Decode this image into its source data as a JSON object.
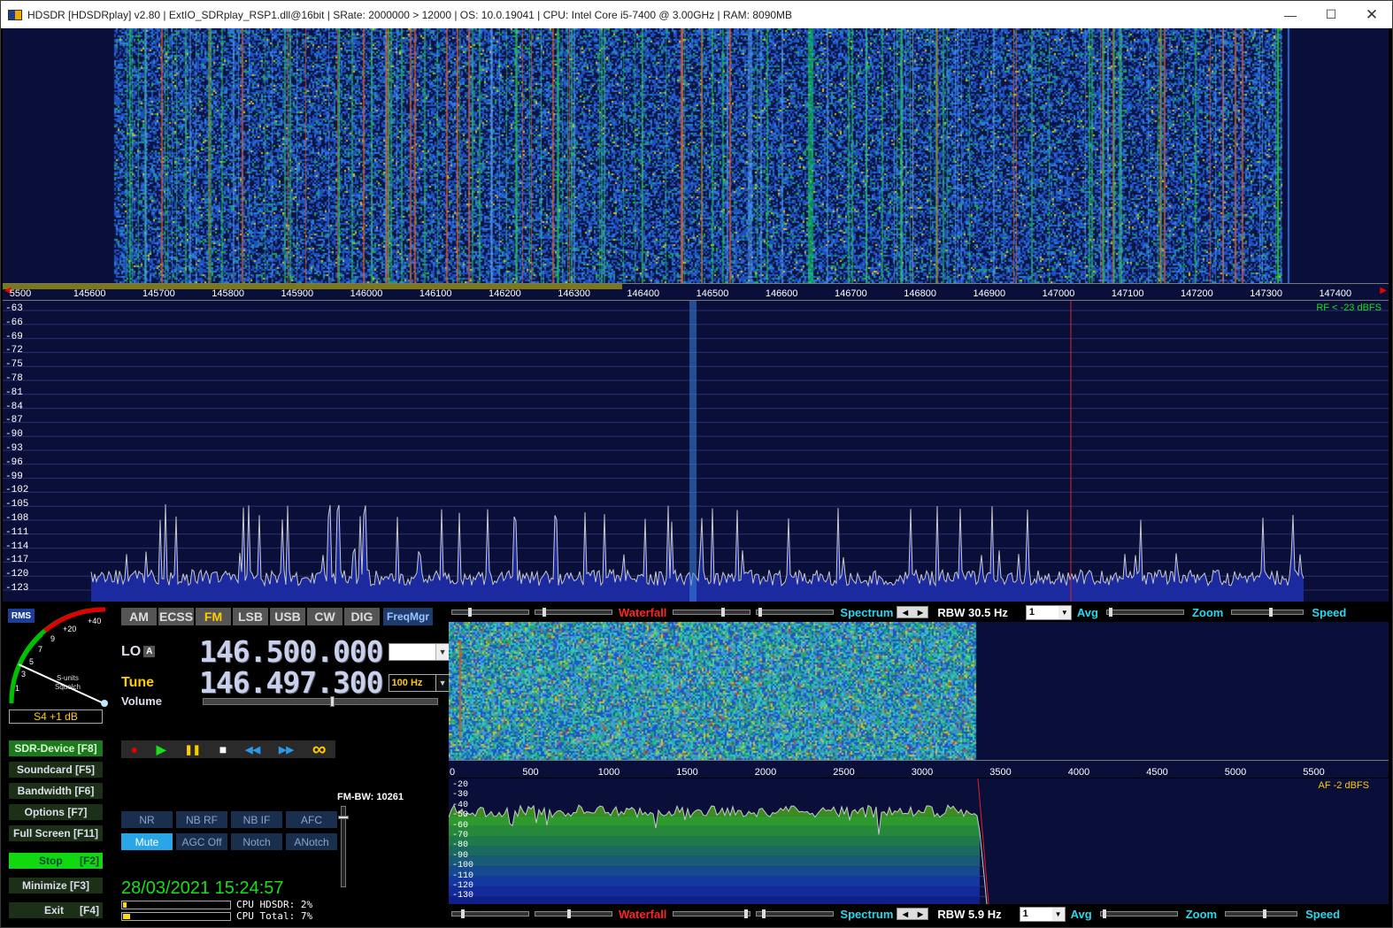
{
  "titlebar": {
    "title": "HDSDR  [HDSDRplay]  v2.80   |  ExtIO_SDRplay_RSP1.dll@16bit  |  SRate: 2000000 > 12000  |  OS: 10.0.19041  |  CPU: Intel Core i5-7400 @ 3.00GHz  |  RAM: 8090MB",
    "minimize": "—",
    "maximize": "☐",
    "close": "✕"
  },
  "freq_scale": {
    "ticks": [
      "5500",
      "145600",
      "145700",
      "145800",
      "145900",
      "146000",
      "146100",
      "146200",
      "146300",
      "146400",
      "146500",
      "146600",
      "146700",
      "146800",
      "146900",
      "147000",
      "147100",
      "147200",
      "147300",
      "147400"
    ]
  },
  "spectrum": {
    "rf_label": "RF < -23 dBFS",
    "db_ticks": [
      "-63",
      "-66",
      "-69",
      "-72",
      "-75",
      "-78",
      "-81",
      "-84",
      "-87",
      "-90",
      "-93",
      "-96",
      "-99",
      "-102",
      "-105",
      "-108",
      "-111",
      "-114",
      "-117",
      "-120",
      "-123"
    ]
  },
  "modes": {
    "items": [
      "AM",
      "ECSS",
      "FM",
      "LSB",
      "USB",
      "CW",
      "DIG"
    ],
    "active": "FM",
    "freqmgr": "FreqMgr"
  },
  "meter": {
    "rms": "RMS",
    "scale_labels": [
      "+40",
      "+20",
      "9",
      "7",
      "5",
      "3",
      "1"
    ],
    "s_units": "S-units",
    "squelch": "Squelch",
    "reading": "S4 +1 dB"
  },
  "lo": {
    "label": "LO",
    "badge": "A",
    "freq": "146.500.000",
    "combo": ""
  },
  "tune": {
    "label": "Tune",
    "freq": "146.497.300",
    "step": "100 Hz"
  },
  "volume": {
    "label": "Volume",
    "level": 0.55
  },
  "sidebar": {
    "sdr_device": "SDR-Device [F8]",
    "soundcard": "Soundcard  [F5]",
    "bandwidth": "Bandwidth  [F6]",
    "options": "Options   [F7]",
    "fullscreen": "Full Screen [F11]",
    "stop": "Stop",
    "stop_key": "[F2]",
    "minimize": "Minimize  [F3]",
    "exit": "Exit",
    "exit_key": "[F4]"
  },
  "transport": {
    "record": "●",
    "play": "▶",
    "pause": "❚❚",
    "stop": "■",
    "rewind": "◀◀",
    "forward": "▶▶",
    "loop": "∞"
  },
  "dsp": {
    "nr": "NR",
    "nb_rf": "NB RF",
    "nb_if": "NB IF",
    "afc": "AFC",
    "mute": "Mute",
    "agc": "AGC Off",
    "notch": "Notch",
    "anotch": "ANotch"
  },
  "fm_bw": "FM-BW: 10261",
  "datetime": "28/03/2021 15:24:57",
  "cpu": {
    "hdsdr": "CPU HDSDR:  2%",
    "total": "CPU Total:  7%",
    "hdsdr_level": 0.02,
    "total_level": 0.07
  },
  "rf_controls": {
    "waterfall": "Waterfall",
    "spectrum": "Spectrum",
    "rbw": "RBW 30.5 Hz",
    "avg_value": "1",
    "avg": "Avg",
    "zoom": "Zoom",
    "speed": "Speed"
  },
  "af_controls": {
    "waterfall": "Waterfall",
    "spectrum": "Spectrum",
    "rbw": "RBW   5.9 Hz",
    "avg_value": "1",
    "avg": "Avg",
    "zoom": "Zoom",
    "speed": "Speed"
  },
  "af_scale": {
    "ticks": [
      "0",
      "500",
      "1000",
      "1500",
      "2000",
      "2500",
      "3000",
      "3500",
      "4000",
      "4500",
      "5000",
      "5500"
    ]
  },
  "af_spectrum": {
    "af_label": "AF  -2 dBFS",
    "db_ticks": [
      "-20",
      "-30",
      "-40",
      "-50",
      "-60",
      "-70",
      "-80",
      "-90",
      "-100",
      "-110",
      "-120",
      "-130"
    ]
  },
  "colors": {
    "accent_yellow": "#ffcc00",
    "green": "#18e018",
    "cyan": "#2ad8f0",
    "red": "#ff2424",
    "bg": "#0a0f3a"
  }
}
